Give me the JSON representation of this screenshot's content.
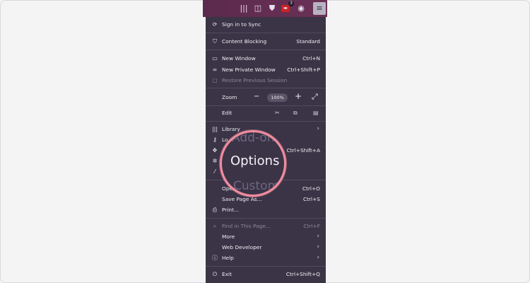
{
  "toolbar": {
    "icons": [
      "library-icon",
      "sidebar-icon",
      "shield-icon",
      "extension-icon",
      "account-icon",
      "menu-icon"
    ],
    "badge_count": "3"
  },
  "menu": {
    "sync": "Sign in to Sync",
    "content_blocking": {
      "label": "Content Blocking",
      "value": "Standard"
    },
    "new_window": {
      "label": "New Window",
      "shortcut": "Ctrl+N"
    },
    "private_window": {
      "label": "New Private Window",
      "shortcut": "Ctrl+Shift+P"
    },
    "restore_session": {
      "label": "Restore Previous Session"
    },
    "zoom": {
      "label": "Zoom",
      "minus": "−",
      "value": "100%",
      "plus": "+",
      "fullscreen": "⤢"
    },
    "edit": {
      "label": "Edit"
    },
    "library": {
      "label": "Library"
    },
    "logins": {
      "label": "Lo"
    },
    "addons": {
      "shortcut": "Ctrl+Shift+A"
    },
    "open_file": {
      "label": "Open",
      "shortcut": "Ctrl+O"
    },
    "save_page": {
      "label": "Save Page As...",
      "shortcut": "Ctrl+S"
    },
    "print": {
      "label": "Print..."
    },
    "find": {
      "label": "Find in This Page...",
      "shortcut": "Ctrl+F"
    },
    "more": {
      "label": "More"
    },
    "web_developer": {
      "label": "Web Developer"
    },
    "help": {
      "label": "Help"
    },
    "exit": {
      "label": "Exit",
      "shortcut": "Ctrl+Shift+Q"
    }
  },
  "magnifier": {
    "top_text": "Add-ons",
    "main_text": "Options",
    "bottom_text": "Customize"
  },
  "colors": {
    "menu_bg": "#3b3446",
    "toolbar_bg": "#5b2a4c",
    "highlight_ring": "#f08ca0"
  }
}
